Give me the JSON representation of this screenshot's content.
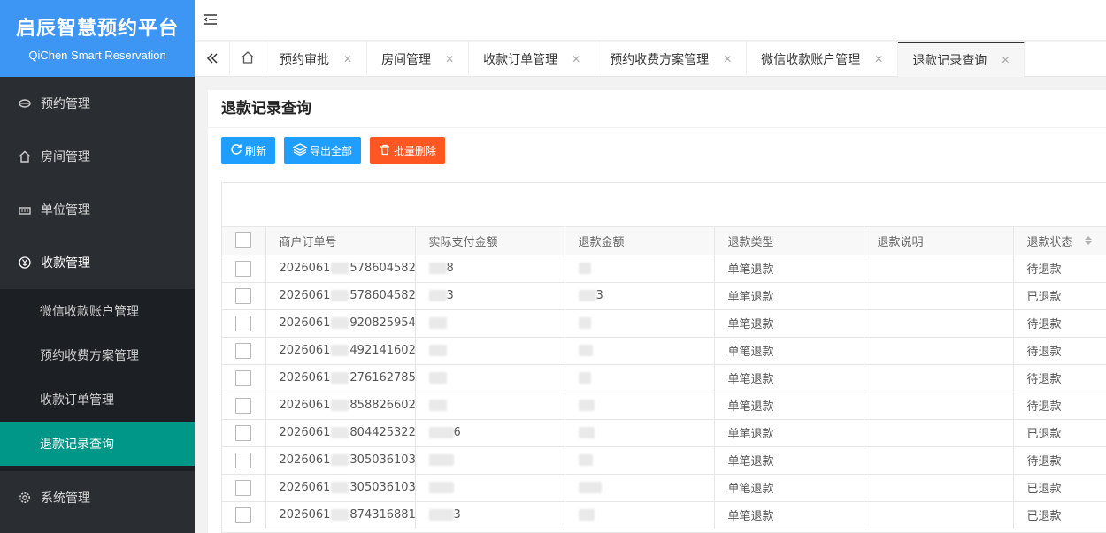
{
  "logo": {
    "title": "启辰智慧预约平台",
    "subtitle": "QiChen Smart Reservation"
  },
  "sidebar": {
    "items": [
      {
        "label": "预约管理",
        "icon": "layers-icon"
      },
      {
        "label": "房间管理",
        "icon": "home-icon"
      },
      {
        "label": "单位管理",
        "icon": "building-icon"
      },
      {
        "label": "收款管理",
        "icon": "yen-icon"
      }
    ],
    "sub_items": [
      {
        "label": "微信收款账户管理"
      },
      {
        "label": "预约收费方案管理"
      },
      {
        "label": "收款订单管理"
      },
      {
        "label": "退款记录查询"
      }
    ],
    "system": {
      "label": "系统管理",
      "icon": "gear-icon"
    }
  },
  "tabs": [
    {
      "label": "预约审批"
    },
    {
      "label": "房间管理"
    },
    {
      "label": "收款订单管理"
    },
    {
      "label": "预约收费方案管理"
    },
    {
      "label": "微信收款账户管理"
    },
    {
      "label": "退款记录查询"
    }
  ],
  "page": {
    "title": "退款记录查询"
  },
  "toolbar": {
    "refresh": "刷新",
    "export_all": "导出全部",
    "batch_delete": "批量删除"
  },
  "table": {
    "headers": [
      "商户订单号",
      "实际支付金额",
      "退款金额",
      "退款类型",
      "退款说明",
      "退款状态"
    ],
    "rows": [
      {
        "order_pre": "2026061",
        "order_suf": "578604582",
        "paid": "8",
        "refund": "",
        "type": "单笔退款",
        "status": "待退款"
      },
      {
        "order_pre": "2026061",
        "order_suf": "578604582",
        "paid": "3",
        "refund": "3",
        "type": "单笔退款",
        "status": "已退款"
      },
      {
        "order_pre": "2026061",
        "order_suf": "920825954",
        "paid": "",
        "refund": "",
        "type": "单笔退款",
        "status": "待退款"
      },
      {
        "order_pre": "2026061",
        "order_suf": "492141602",
        "paid": "",
        "refund": "",
        "type": "单笔退款",
        "status": "待退款"
      },
      {
        "order_pre": "2026061",
        "order_suf": "276162785",
        "paid": "",
        "refund": "",
        "type": "单笔退款",
        "status": "待退款"
      },
      {
        "order_pre": "2026061",
        "order_suf": "858826602",
        "paid": "",
        "refund": "",
        "type": "单笔退款",
        "status": "待退款"
      },
      {
        "order_pre": "2026061",
        "order_suf": "804425322",
        "paid": "6",
        "refund": "",
        "type": "单笔退款",
        "status": "已退款"
      },
      {
        "order_pre": "2026061",
        "order_suf": "305036103",
        "paid": "",
        "refund": "",
        "type": "单笔退款",
        "status": "待退款"
      },
      {
        "order_pre": "2026061",
        "order_suf": "305036103",
        "paid": "",
        "refund": "",
        "type": "单笔退款",
        "status": "已退款"
      },
      {
        "order_pre": "2026061",
        "order_suf": "874316881",
        "paid": "3",
        "refund": "",
        "type": "单笔退款",
        "status": "已退款"
      }
    ]
  }
}
